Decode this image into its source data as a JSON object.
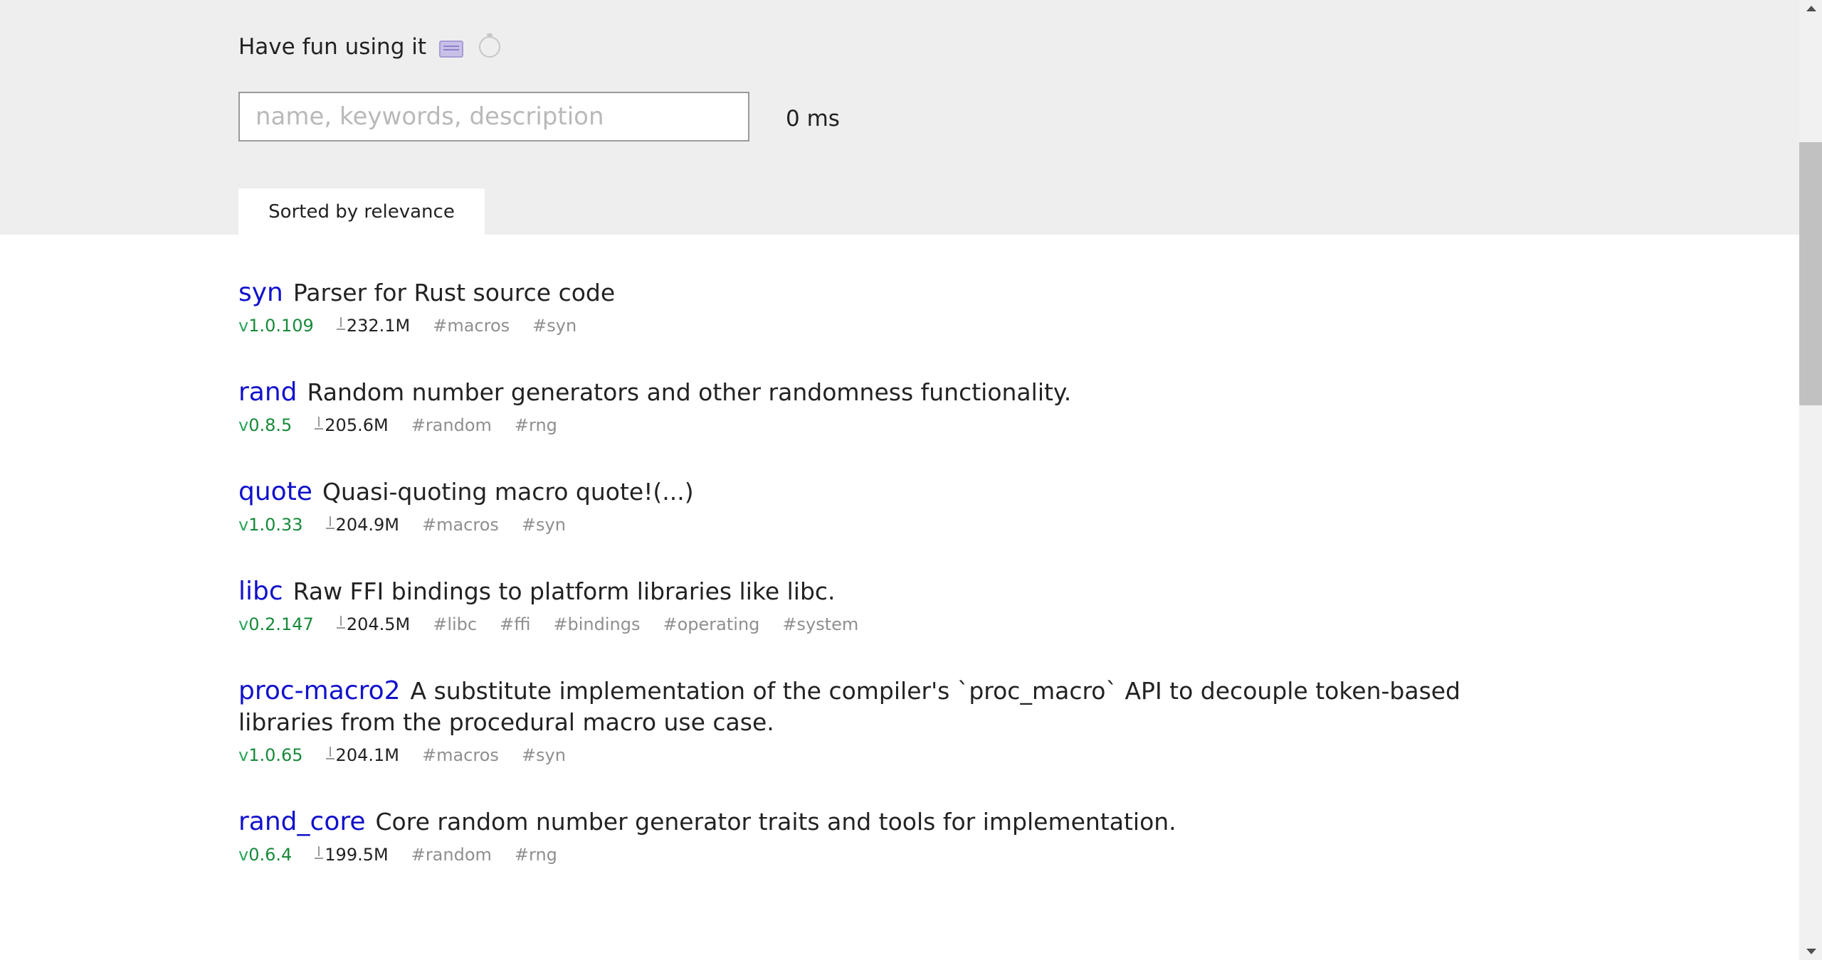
{
  "header": {
    "tagline": "Have fun using it",
    "keyboard_icon": "keyboard-icon",
    "timer_icon": "timer-icon",
    "search": {
      "value": "",
      "placeholder": "name, keywords, description"
    },
    "timing": "0 ms",
    "sort_label": "Sorted by relevance"
  },
  "results": [
    {
      "name": "syn",
      "description": "Parser for Rust source code",
      "version_prefix": "v",
      "version": "1.0.109",
      "downloads": "232.1M",
      "tags": [
        "#macros",
        "#syn"
      ]
    },
    {
      "name": "rand",
      "description": "Random number generators and other randomness functionality.",
      "version_prefix": "v",
      "version": "0.8.5",
      "downloads": "205.6M",
      "tags": [
        "#random",
        "#rng"
      ]
    },
    {
      "name": "quote",
      "description": "Quasi-quoting macro quote!(...)",
      "version_prefix": "v",
      "version": "1.0.33",
      "downloads": "204.9M",
      "tags": [
        "#macros",
        "#syn"
      ]
    },
    {
      "name": "libc",
      "description": "Raw FFI bindings to platform libraries like libc.",
      "version_prefix": "v",
      "version": "0.2.147",
      "downloads": "204.5M",
      "tags": [
        "#libc",
        "#ffi",
        "#bindings",
        "#operating",
        "#system"
      ]
    },
    {
      "name": "proc-macro2",
      "description": "A substitute implementation of the compiler's `proc_macro` API to decouple token-based libraries from the procedural macro use case.",
      "version_prefix": "v",
      "version": "1.0.65",
      "downloads": "204.1M",
      "tags": [
        "#macros",
        "#syn"
      ]
    },
    {
      "name": "rand_core",
      "description": "Core random number generator traits and tools for implementation.",
      "version_prefix": "v",
      "version": "0.6.4",
      "downloads": "199.5M",
      "tags": [
        "#random",
        "#rng"
      ]
    }
  ],
  "colors": {
    "header_bg": "#eeeeee",
    "link": "#1111cc",
    "version": "#178a3a",
    "tag": "#8f8f8f"
  }
}
